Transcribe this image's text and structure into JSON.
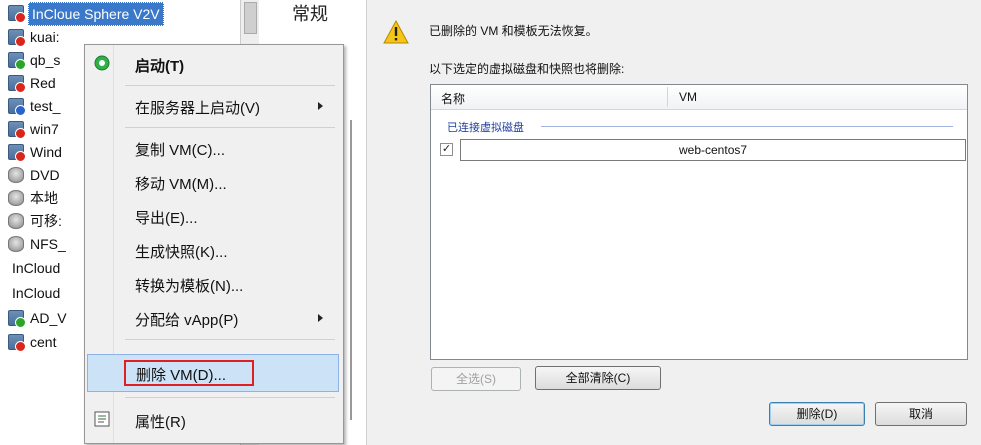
{
  "tree": {
    "selected_label": "InCloue Sphere V2V",
    "items": [
      {
        "label": "kuai:",
        "icon": "vm-red-icon"
      },
      {
        "label": "qb_s",
        "icon": "vm-green-icon"
      },
      {
        "label": "Red",
        "icon": "vm-red-icon"
      },
      {
        "label": "test_",
        "icon": "vm-blue-icon"
      },
      {
        "label": "win7",
        "icon": "vm-red-icon"
      },
      {
        "label": "Wind",
        "icon": "vm-red-icon"
      },
      {
        "label": "DVD",
        "icon": "disk-icon"
      },
      {
        "label": "本地",
        "icon": "disk-icon"
      },
      {
        "label": "可移:",
        "icon": "disk-icon"
      },
      {
        "label": "NFS_",
        "icon": "disk-icon"
      },
      {
        "label": "InCloud",
        "icon": ""
      },
      {
        "label": "InCloud",
        "icon": ""
      },
      {
        "label": "AD_V",
        "icon": "vm-green-icon"
      },
      {
        "label": "cent",
        "icon": "vm-red-icon"
      }
    ],
    "tab_caption": "常规"
  },
  "context_menu": {
    "items": [
      {
        "label": "启动(T)",
        "submenu": false,
        "icon": "start-icon"
      },
      {
        "label": "在服务器上启动(V)",
        "submenu": true
      },
      {
        "label": "复制 VM(C)...",
        "submenu": false
      },
      {
        "label": "移动 VM(M)...",
        "submenu": false
      },
      {
        "label": "导出(E)...",
        "submenu": false
      },
      {
        "label": "生成快照(K)...",
        "submenu": false
      },
      {
        "label": "转换为模板(N)...",
        "submenu": false
      },
      {
        "label": "分配给 vApp(P)",
        "submenu": true
      },
      {
        "label": "删除 VM(D)...",
        "submenu": false,
        "highlighted": true
      },
      {
        "label": "属性(R)",
        "submenu": false,
        "icon": "properties-icon"
      }
    ]
  },
  "dialog": {
    "warning": "已删除的 VM 和模板无法恢复。",
    "instruction": "以下选定的虚拟磁盘和快照也将删除:",
    "columns": [
      "名称",
      "VM"
    ],
    "group_label": "已连接虚拟磁盘",
    "rows": [
      {
        "checked": true,
        "check_glyph": "✓",
        "vm": "web-centos7"
      }
    ],
    "select_all": "全选(S)",
    "clear_all": "全部清除(C)",
    "delete_button": "删除(D)",
    "cancel_button": "取消"
  }
}
